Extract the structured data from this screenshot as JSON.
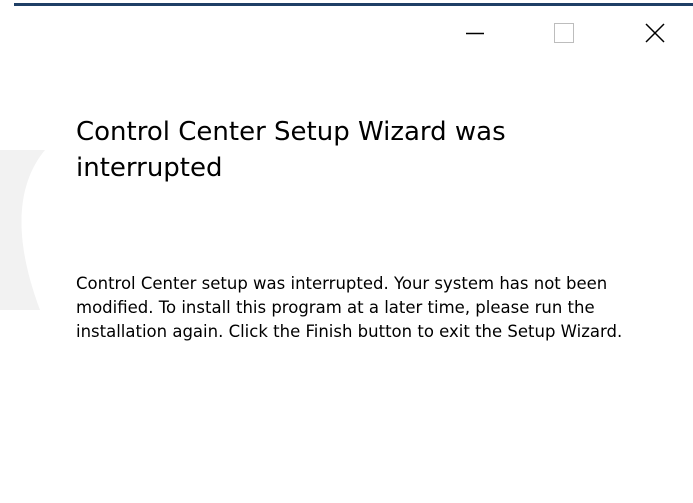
{
  "window": {
    "accent_color": "#1f3f66",
    "background_color": "#ffffff"
  },
  "title_bar": {
    "buttons": [
      {
        "name": "minimize",
        "icon": "minimize-icon"
      },
      {
        "name": "maximize",
        "icon": "maximize-icon",
        "state": "disabled"
      },
      {
        "name": "close",
        "icon": "close-icon"
      }
    ]
  },
  "content": {
    "heading": "Control Center Setup Wizard was interrupted",
    "message": "Control Center setup was interrupted. Your system has not been modified. To install this program at a later time, please run the installation again. Click the Finish button to exit the Setup Wizard."
  }
}
